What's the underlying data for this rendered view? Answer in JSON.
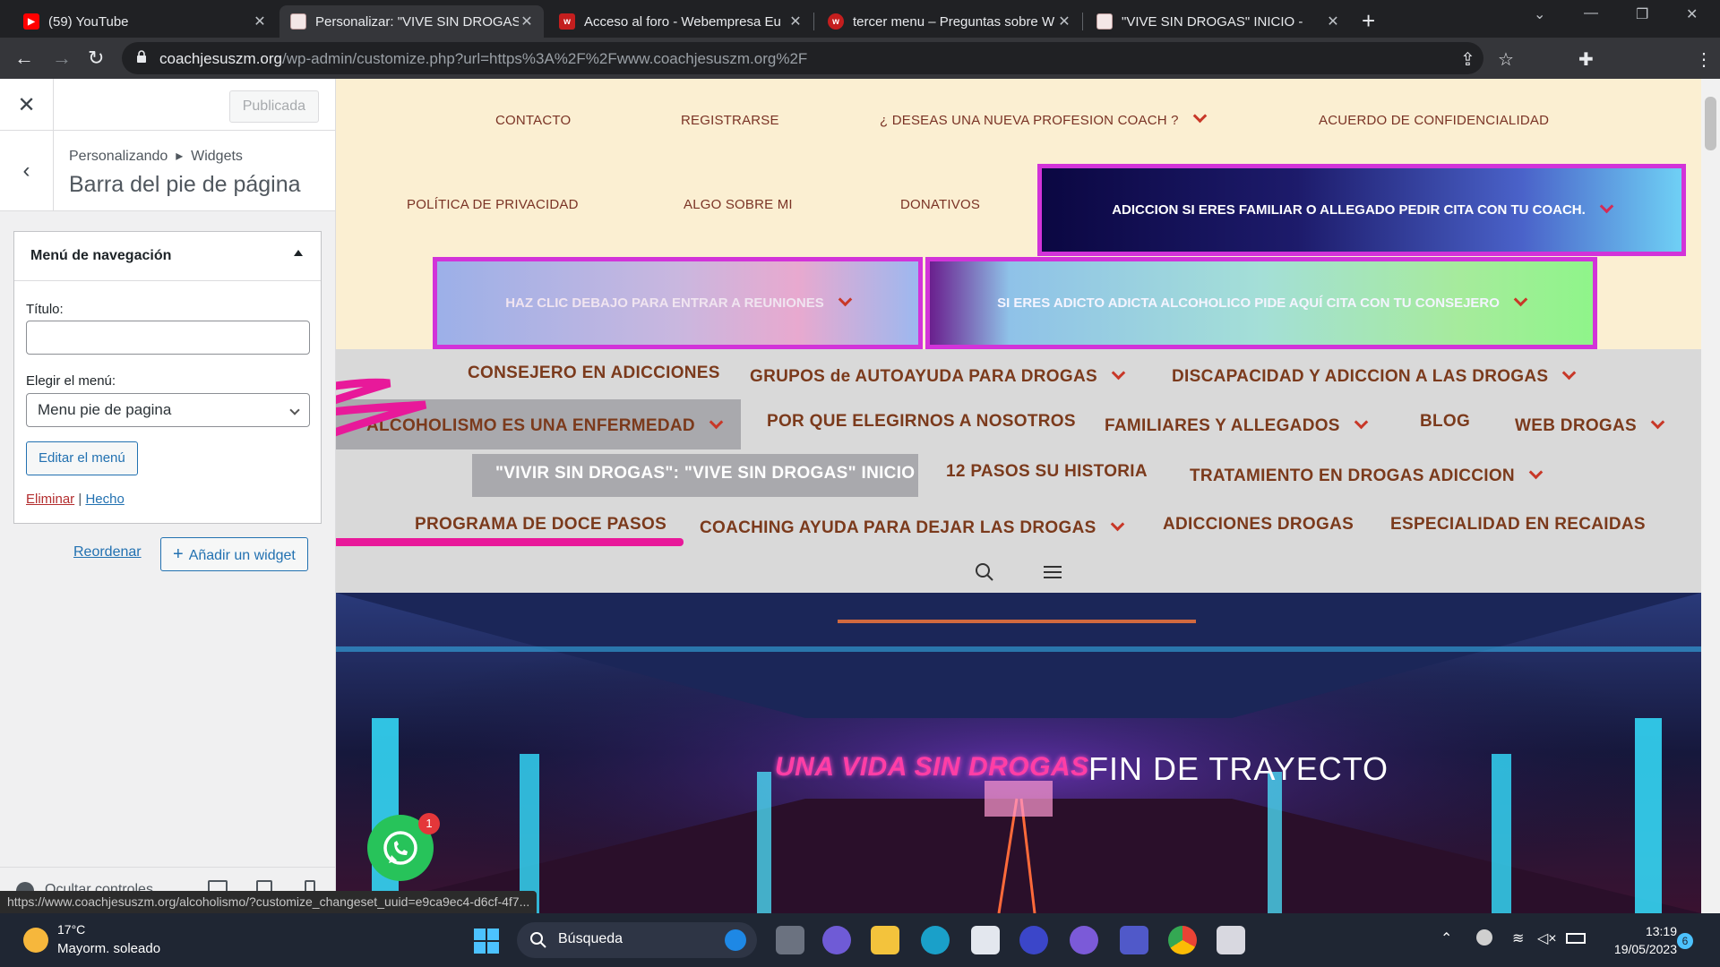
{
  "browser": {
    "tabs": [
      {
        "title": "(59) YouTube",
        "favicon": "youtube-icon",
        "active": false
      },
      {
        "title": "Personalizar: \"VIVE SIN DROGAS\"",
        "favicon": "site-icon",
        "active": true
      },
      {
        "title": "Acceso al foro - Webempresa Eu",
        "favicon": "webempresa-icon",
        "active": false
      },
      {
        "title": "tercer menu – Preguntas sobre W",
        "favicon": "webempresa-icon",
        "active": false
      },
      {
        "title": "\"VIVE SIN DROGAS\" INICIO -",
        "favicon": "site-icon",
        "active": false
      }
    ],
    "url_domain": "coachjesuszm.org",
    "url_path": "/wp-admin/customize.php?url=https%3A%2F%2Fwww.coachjesuszm.org%2F",
    "status_url": "https://www.coachjesuszm.org/alcoholismo/?customize_changeset_uuid=e9ca9ec4-d6cf-4f7..."
  },
  "customizer": {
    "publish_label": "Publicada",
    "breadcrumb_parent": "Personalizando",
    "breadcrumb_child": "Widgets",
    "section_title": "Barra del pie de página",
    "widget": {
      "title": "Menú de navegación",
      "title_label": "Título:",
      "title_value": "",
      "menu_label": "Elegir el menú:",
      "menu_value": "Menu pie de pagina",
      "edit_menu": "Editar el menú",
      "delete": "Eliminar",
      "separator": "|",
      "done": "Hecho"
    },
    "reorder": "Reordenar",
    "add_widget": "Añadir un widget",
    "hide_controls": "Ocultar controles"
  },
  "site": {
    "top_menu": [
      {
        "label": "CONTACTO"
      },
      {
        "label": "REGISTRARSE"
      },
      {
        "label": "¿ DESEAS UNA NUEVA PROFESION COACH ?"
      },
      {
        "label": "ACUERDO DE CONFIDENCIALIDAD"
      },
      {
        "label": "POLÍTICA DE PRIVACIDAD"
      },
      {
        "label": "ALGO SOBRE MI"
      },
      {
        "label": "DONATIVOS"
      }
    ],
    "gradient_items": [
      {
        "label": "ADICCION SI ERES FAMILIAR O ALLEGADO PEDIR CITA CON TU COACH."
      },
      {
        "label": "HAZ CLIC DEBAJO PARA ENTRAR A REUNIONES"
      },
      {
        "label": "SI ERES ADICTO ADICTA ALCOHOLICO PIDE AQUÍ CITA CON TU CONSEJERO"
      }
    ],
    "main_menu": [
      {
        "label": "CONSEJERO EN ADICCIONES"
      },
      {
        "label": "GRUPOS de AUTOAYUDA PARA DROGAS"
      },
      {
        "label": "DISCAPACIDAD Y ADICCION A LAS DROGAS"
      },
      {
        "label": "ALCOHOLISMO ES UNA ENFERMEDAD"
      },
      {
        "label": "POR QUE ELEGIRNOS A NOSOTROS"
      },
      {
        "label": "FAMILIARES Y ALLEGADOS"
      },
      {
        "label": "BLOG"
      },
      {
        "label": "WEB DROGAS"
      },
      {
        "label": "\"VIVIR SIN DROGAS\": \"VIVE SIN DROGAS\" INICIO"
      },
      {
        "label": "12 PASOS SU HISTORIA"
      },
      {
        "label": "TRATAMIENTO EN DROGAS ADICCION"
      },
      {
        "label": "PROGRAMA DE DOCE PASOS"
      },
      {
        "label": "COACHING AYUDA PARA DEJAR LAS DROGAS"
      },
      {
        "label": "ADICCIONES DROGAS"
      },
      {
        "label": "ESPECIALIDAD EN RECAIDAS"
      }
    ],
    "hero_left": "UNA VIDA SIN DROGAS",
    "hero_right": "FIN DE TRAYECTO",
    "whatsapp_badge": "1"
  },
  "taskbar": {
    "temperature": "17°C",
    "weather": "Mayorm. soleado",
    "search_label": "Búsqueda",
    "time": "13:19",
    "date": "19/05/2023",
    "notifications": "6"
  },
  "colors": {
    "menu_text": "#7a3325",
    "chevron": "#c83828",
    "annotation": "#e8199a",
    "wp_blue": "#2271b1"
  }
}
